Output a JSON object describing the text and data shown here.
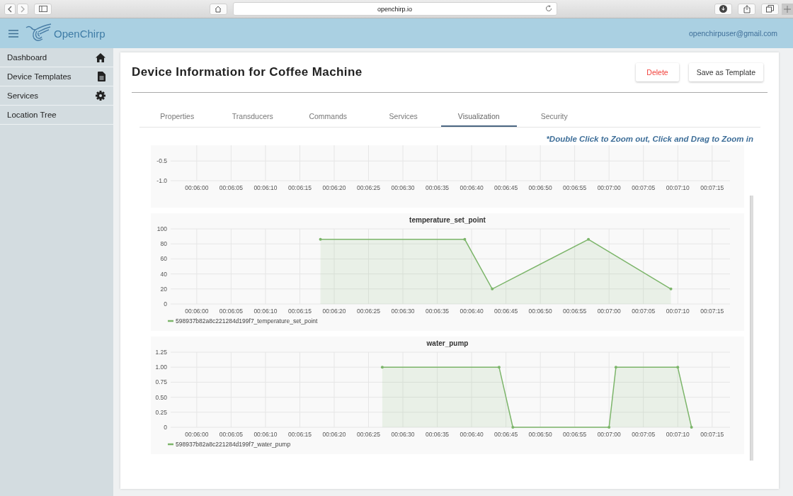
{
  "browser": {
    "url": "openchirp.io"
  },
  "header": {
    "brand": "OpenChirp",
    "user_email": "openchirpuser@gmail.com"
  },
  "sidebar": {
    "items": [
      {
        "label": "Dashboard",
        "selected": false
      },
      {
        "label": "Device Templates",
        "selected": false
      },
      {
        "label": "Services",
        "selected": false
      },
      {
        "label": "Location Tree",
        "selected": false
      }
    ]
  },
  "page": {
    "title": "Device Information for Coffee Machine",
    "buttons": [
      {
        "label": "Delete",
        "kind": "danger"
      },
      {
        "label": "Save as Template",
        "kind": "default"
      }
    ]
  },
  "tabs": [
    {
      "label": "Properties",
      "selected": false
    },
    {
      "label": "Transducers",
      "selected": false
    },
    {
      "label": "Commands",
      "selected": false
    },
    {
      "label": "Services",
      "selected": false
    },
    {
      "label": "Visualization",
      "selected": true
    },
    {
      "label": "Security",
      "selected": false
    }
  ],
  "hint": "*Double Click to Zoom out, Click and Drag to Zoom in",
  "charts": [
    {
      "chart_data": {
        "type": "area",
        "grid": true,
        "xlim": [
          356.2,
          437.6
        ],
        "ylim": [
          -1.0,
          -0.1
        ],
        "xticks": [
          {
            "value": 360,
            "label": "00:06:00"
          },
          {
            "value": 365,
            "label": "00:06:05"
          },
          {
            "value": 370,
            "label": "00:06:10"
          },
          {
            "value": 375,
            "label": "00:06:15"
          },
          {
            "value": 380,
            "label": "00:06:20"
          },
          {
            "value": 385,
            "label": "00:06:25"
          },
          {
            "value": 390,
            "label": "00:06:30"
          },
          {
            "value": 395,
            "label": "00:06:35"
          },
          {
            "value": 400,
            "label": "00:06:40"
          },
          {
            "value": 405,
            "label": "00:06:45"
          },
          {
            "value": 410,
            "label": "00:06:50"
          },
          {
            "value": 415,
            "label": "00:06:55"
          },
          {
            "value": 420,
            "label": "00:07:00"
          },
          {
            "value": 425,
            "label": "00:07:05"
          },
          {
            "value": 430,
            "label": "00:07:10"
          },
          {
            "value": 435,
            "label": "00:07:15"
          }
        ],
        "yticks": [
          {
            "value": -0.5,
            "label": "-0.5"
          },
          {
            "value": -1.0,
            "label": "-1.0"
          }
        ]
      }
    },
    {
      "chart_data": {
        "type": "area",
        "grid": true,
        "title": "temperature_set_point",
        "xlim": [
          356.2,
          437.6
        ],
        "ylim": [
          0,
          100
        ],
        "xticks": [
          {
            "value": 360,
            "label": "00:06:00"
          },
          {
            "value": 365,
            "label": "00:06:05"
          },
          {
            "value": 370,
            "label": "00:06:10"
          },
          {
            "value": 375,
            "label": "00:06:15"
          },
          {
            "value": 380,
            "label": "00:06:20"
          },
          {
            "value": 385,
            "label": "00:06:25"
          },
          {
            "value": 390,
            "label": "00:06:30"
          },
          {
            "value": 395,
            "label": "00:06:35"
          },
          {
            "value": 400,
            "label": "00:06:40"
          },
          {
            "value": 405,
            "label": "00:06:45"
          },
          {
            "value": 410,
            "label": "00:06:50"
          },
          {
            "value": 415,
            "label": "00:06:55"
          },
          {
            "value": 420,
            "label": "00:07:00"
          },
          {
            "value": 425,
            "label": "00:07:05"
          },
          {
            "value": 430,
            "label": "00:07:10"
          },
          {
            "value": 435,
            "label": "00:07:15"
          }
        ],
        "yticks": [
          0,
          20,
          40,
          60,
          80,
          100
        ],
        "x": [
          378,
          399,
          403,
          417,
          429
        ],
        "series": [
          {
            "name": "598937b82a8c221284d199f7_temperature_set_point",
            "color": "#7cb56a",
            "values": [
              86,
              86,
              20,
              86,
              20
            ]
          }
        ]
      }
    },
    {
      "chart_data": {
        "type": "area",
        "grid": true,
        "title": "water_pump",
        "xlim": [
          356.2,
          437.6
        ],
        "ylim": [
          0,
          1.25
        ],
        "xticks": [
          {
            "value": 360,
            "label": "00:06:00"
          },
          {
            "value": 365,
            "label": "00:06:05"
          },
          {
            "value": 370,
            "label": "00:06:10"
          },
          {
            "value": 375,
            "label": "00:06:15"
          },
          {
            "value": 380,
            "label": "00:06:20"
          },
          {
            "value": 385,
            "label": "00:06:25"
          },
          {
            "value": 390,
            "label": "00:06:30"
          },
          {
            "value": 395,
            "label": "00:06:35"
          },
          {
            "value": 400,
            "label": "00:06:40"
          },
          {
            "value": 405,
            "label": "00:06:45"
          },
          {
            "value": 410,
            "label": "00:06:50"
          },
          {
            "value": 415,
            "label": "00:06:55"
          },
          {
            "value": 420,
            "label": "00:07:00"
          },
          {
            "value": 425,
            "label": "00:07:05"
          },
          {
            "value": 430,
            "label": "00:07:10"
          },
          {
            "value": 435,
            "label": "00:07:15"
          }
        ],
        "yticks": [
          {
            "value": 0,
            "label": "0"
          },
          {
            "value": 0.25,
            "label": "0.25"
          },
          {
            "value": 0.5,
            "label": "0.50"
          },
          {
            "value": 0.75,
            "label": "0.75"
          },
          {
            "value": 1.0,
            "label": "1.00"
          },
          {
            "value": 1.25,
            "label": "1.25"
          }
        ],
        "x": [
          387,
          404,
          406,
          420,
          421,
          430,
          432
        ],
        "series": [
          {
            "name": "598937b82a8c221284d199f7_water_pump",
            "color": "#7cb56a",
            "values": [
              1,
              1,
              0,
              0,
              1,
              1,
              0
            ]
          }
        ]
      }
    }
  ]
}
